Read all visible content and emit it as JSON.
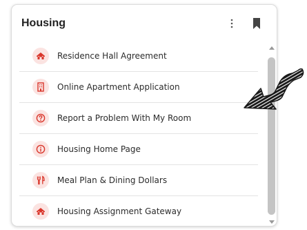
{
  "widget": {
    "title": "Housing",
    "menu_icon": "kebab-menu-icon",
    "bookmark_icon": "bookmark-icon"
  },
  "links": [
    {
      "label": "Residence Hall Agreement",
      "icon": "house-icon"
    },
    {
      "label": "Online Apartment Application",
      "icon": "building-icon"
    },
    {
      "label": "Report a Problem With My Room",
      "icon": "question-circle-icon"
    },
    {
      "label": "Housing Home Page",
      "icon": "info-circle-icon"
    },
    {
      "label": "Meal Plan & Dining Dollars",
      "icon": "utensils-icon"
    },
    {
      "label": "Housing Assignment Gateway",
      "icon": "house-icon"
    }
  ],
  "colors": {
    "accent": "#d9362b",
    "icon_bg": "#fbe3e1",
    "text": "#2b2b2b",
    "divider": "#e3e3e3",
    "scroll_thumb": "#c4c4c4",
    "pointer": "#1a1a1a"
  }
}
